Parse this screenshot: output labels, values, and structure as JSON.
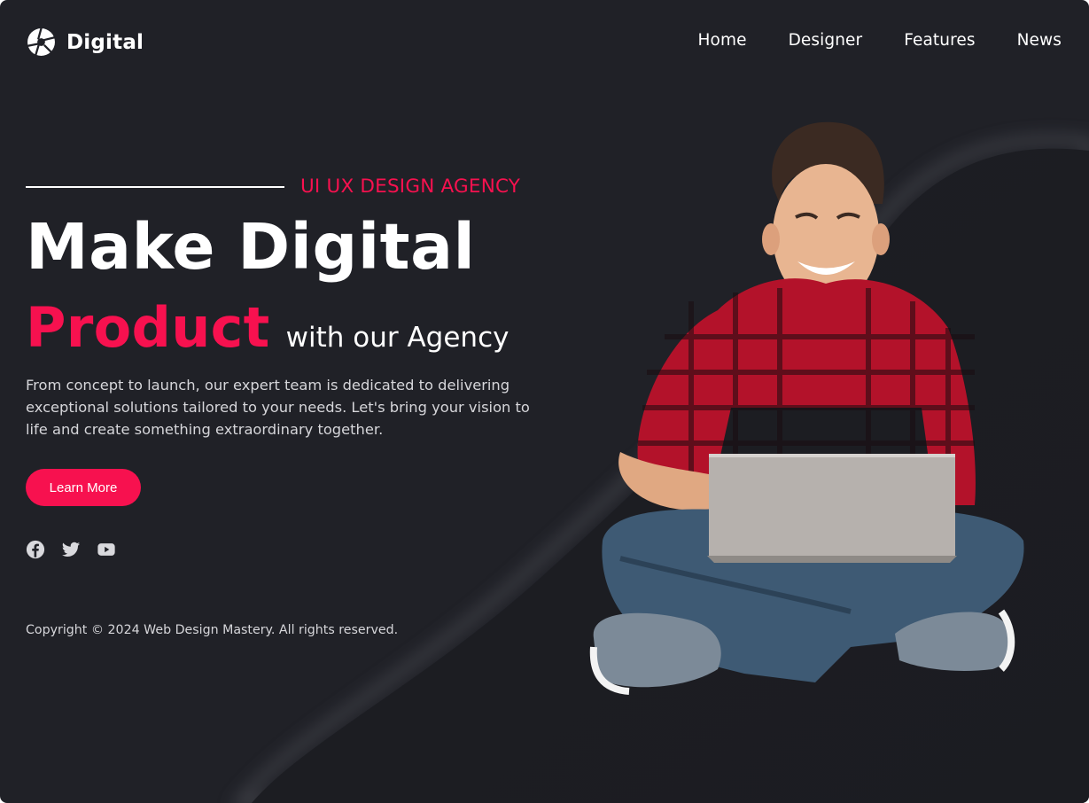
{
  "brand": {
    "name": "Digital",
    "accent_color": "#f7114f",
    "background_color": "#202127"
  },
  "nav": {
    "items": [
      {
        "label": "Home"
      },
      {
        "label": "Designer"
      },
      {
        "label": "Features"
      },
      {
        "label": "News"
      }
    ]
  },
  "hero": {
    "eyebrow": "UI UX DESIGN AGENCY",
    "headline": "Make Digital",
    "highlight": "Product",
    "subheadline": "with our Agency",
    "description": "From concept to launch, our expert team is dedicated to delivering exceptional solutions tailored to your needs. Let's bring your vision to life and create something extraordinary together.",
    "cta_label": "Learn More",
    "image_alt": "man-with-laptop"
  },
  "socials": [
    {
      "icon": "facebook-icon"
    },
    {
      "icon": "twitter-icon"
    },
    {
      "icon": "youtube-icon"
    }
  ],
  "footer": {
    "copyright": "Copyright © 2024 Web Design Mastery. All rights reserved."
  }
}
